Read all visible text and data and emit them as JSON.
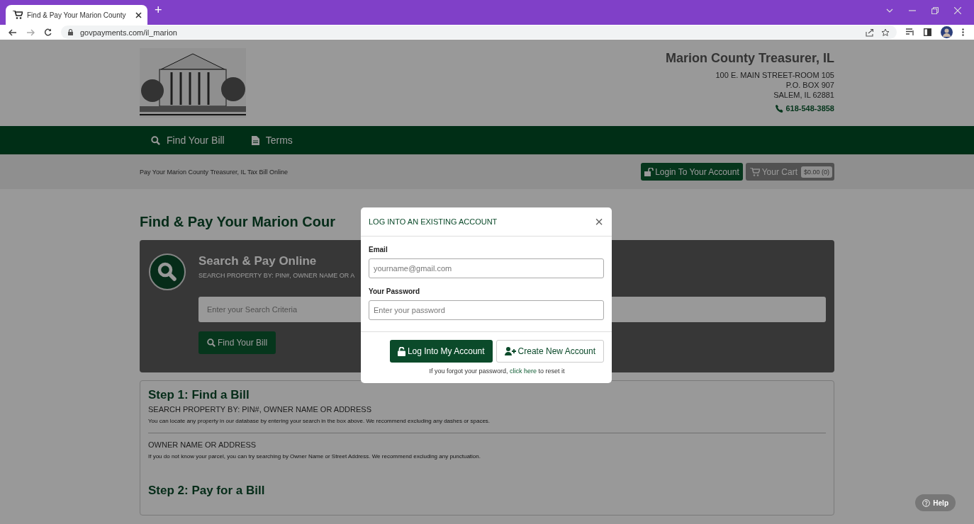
{
  "browser": {
    "tab_title": "Find & Pay Your Marion County",
    "new_tab": "+",
    "url": "govpayments.com/il_marion"
  },
  "header": {
    "title": "Marion County Treasurer, IL",
    "address": [
      "100 E. MAIN STREET-ROOM 105",
      "P.O. BOX 907",
      "SALEM, IL 62881"
    ],
    "phone": "618-548-3858"
  },
  "nav": [
    {
      "label": "Find Your Bill",
      "kind": "search"
    },
    {
      "label": "Terms",
      "kind": "document"
    }
  ],
  "subbar": {
    "tagline": "Pay Your Marion County Treasurer, IL Tax Bill Online",
    "login": "Login To Your Account",
    "cart": "Your Cart",
    "cart_total": "$0.00 (0)"
  },
  "page_title": "Find & Pay Your Marion Cour",
  "search_panel": {
    "title": "Search & Pay Online",
    "subtitle": "SEARCH PROPERTY BY: PIN#, OWNER NAME OR A",
    "placeholder": "Enter your Search Criteria",
    "button": "Find Your Bill"
  },
  "steps": [
    {
      "title": "Step 1: Find a Bill",
      "sections": [
        {
          "heading": "SEARCH PROPERTY BY: PIN#, OWNER NAME OR ADDRESS",
          "text": "You can locate any property in our database by entering your search in the box above. We recommend excluding any dashes or spaces."
        },
        {
          "heading": "OWNER NAME OR ADDRESS",
          "text": "If you do not know your parcel, you can try searching by Owner Name or Street Address. We recommend excluding any punctuation."
        }
      ]
    },
    {
      "title": "Step 2: Pay for a Bill"
    }
  ],
  "modal": {
    "title": "LOG INTO AN EXISTING ACCOUNT",
    "close": "×",
    "email_label": "Email",
    "email_placeholder": "yourname@gmail.com",
    "password_label": "Your Password",
    "password_placeholder": "Enter your password",
    "login_button": "Log Into My Account",
    "create_button": "Create New Account",
    "forgot_before": "If you forgot your password,",
    "forgot_link": "click here",
    "forgot_after": "to reset it"
  },
  "help": "Help"
}
